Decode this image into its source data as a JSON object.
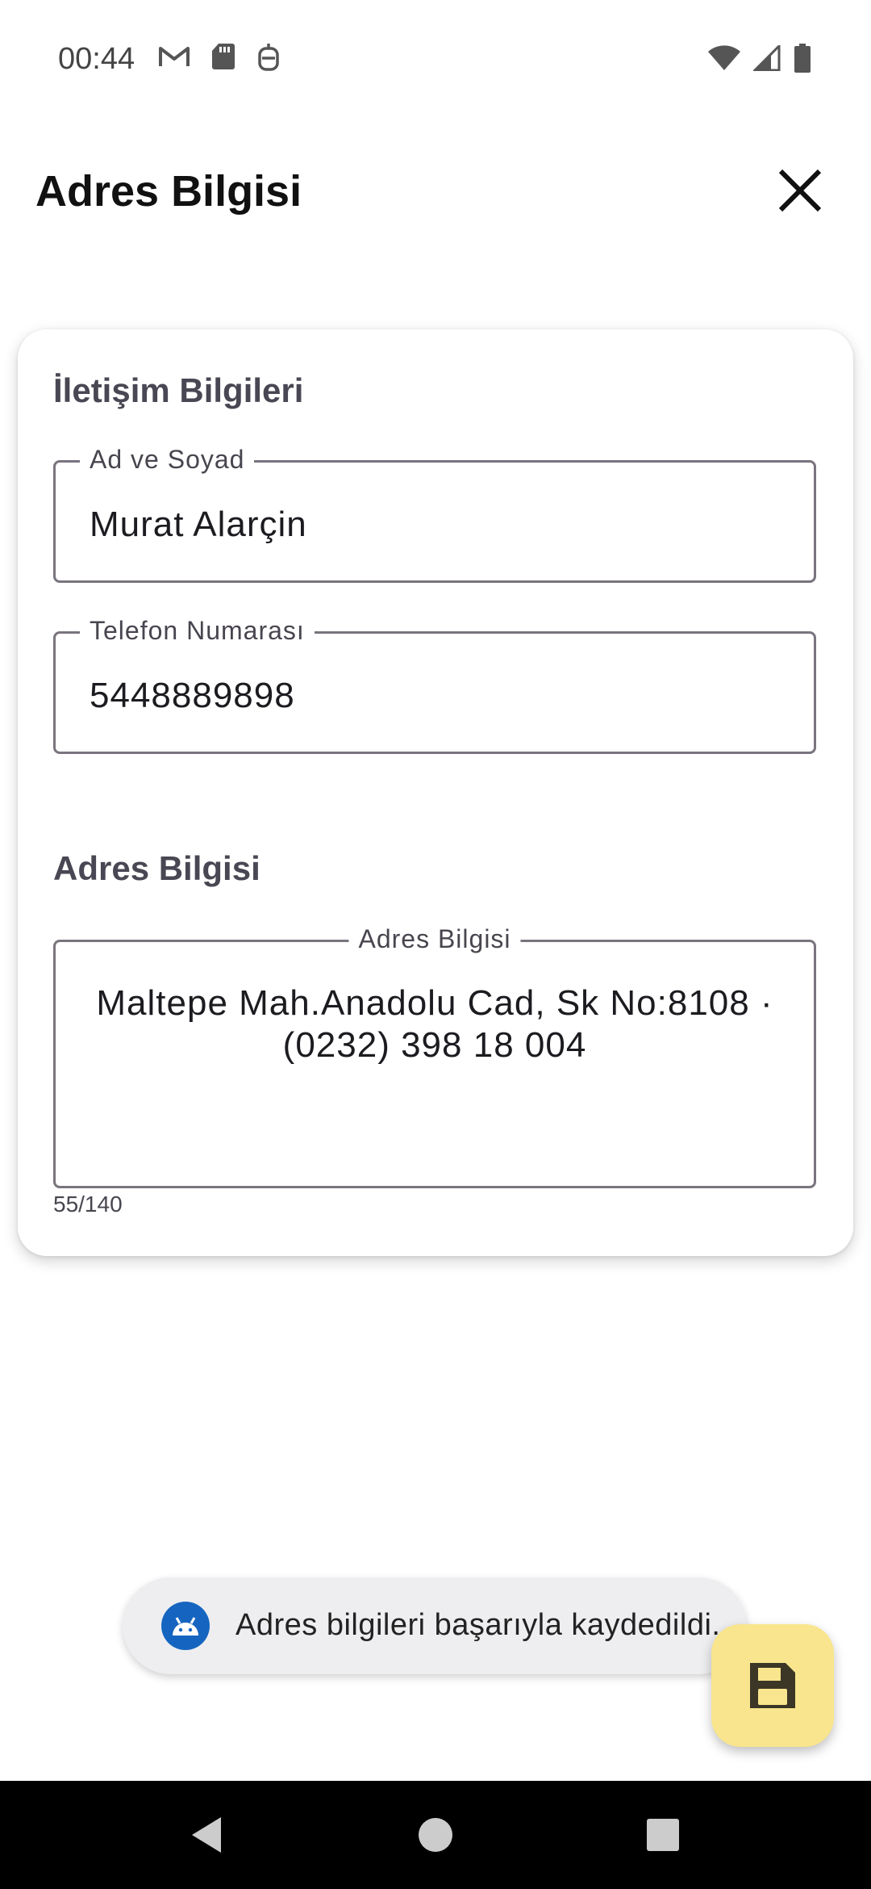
{
  "status_bar": {
    "time": "00:44",
    "left_icons": [
      "gmail-icon",
      "sd-card-icon",
      "accessibility-icon"
    ],
    "right_icons": [
      "wifi-icon",
      "signal-icon",
      "battery-icon"
    ]
  },
  "app_bar": {
    "title": "Adres Bilgisi",
    "close_icon": "close-icon"
  },
  "contact_section": {
    "title": "İletişim Bilgileri",
    "name_field": {
      "label": "Ad ve Soyad",
      "value": "Murat Alarçin"
    },
    "phone_field": {
      "label": "Telefon Numarası",
      "value": "5448889898"
    }
  },
  "address_section": {
    "title": "Adres Bilgisi",
    "address_field": {
      "label": "Adres Bilgisi",
      "line1": "Maltepe Mah.Anadolu Cad, Sk No:8108 ·",
      "line2": "(0232) 398 18 004",
      "counter": "55/140"
    }
  },
  "snackbar": {
    "icon": "android-icon",
    "message": "Adres bilgileri başarıyla kaydedildi."
  },
  "fab": {
    "icon": "save-icon"
  },
  "nav_bar": {
    "buttons": [
      "back-icon",
      "home-icon",
      "recents-icon"
    ]
  },
  "colors": {
    "fab": "#f8e58d",
    "snackbar_bg": "#eeeef0",
    "snackbar_icon": "#1565c0",
    "outline": "#79747e",
    "section_title": "#4a4754"
  }
}
